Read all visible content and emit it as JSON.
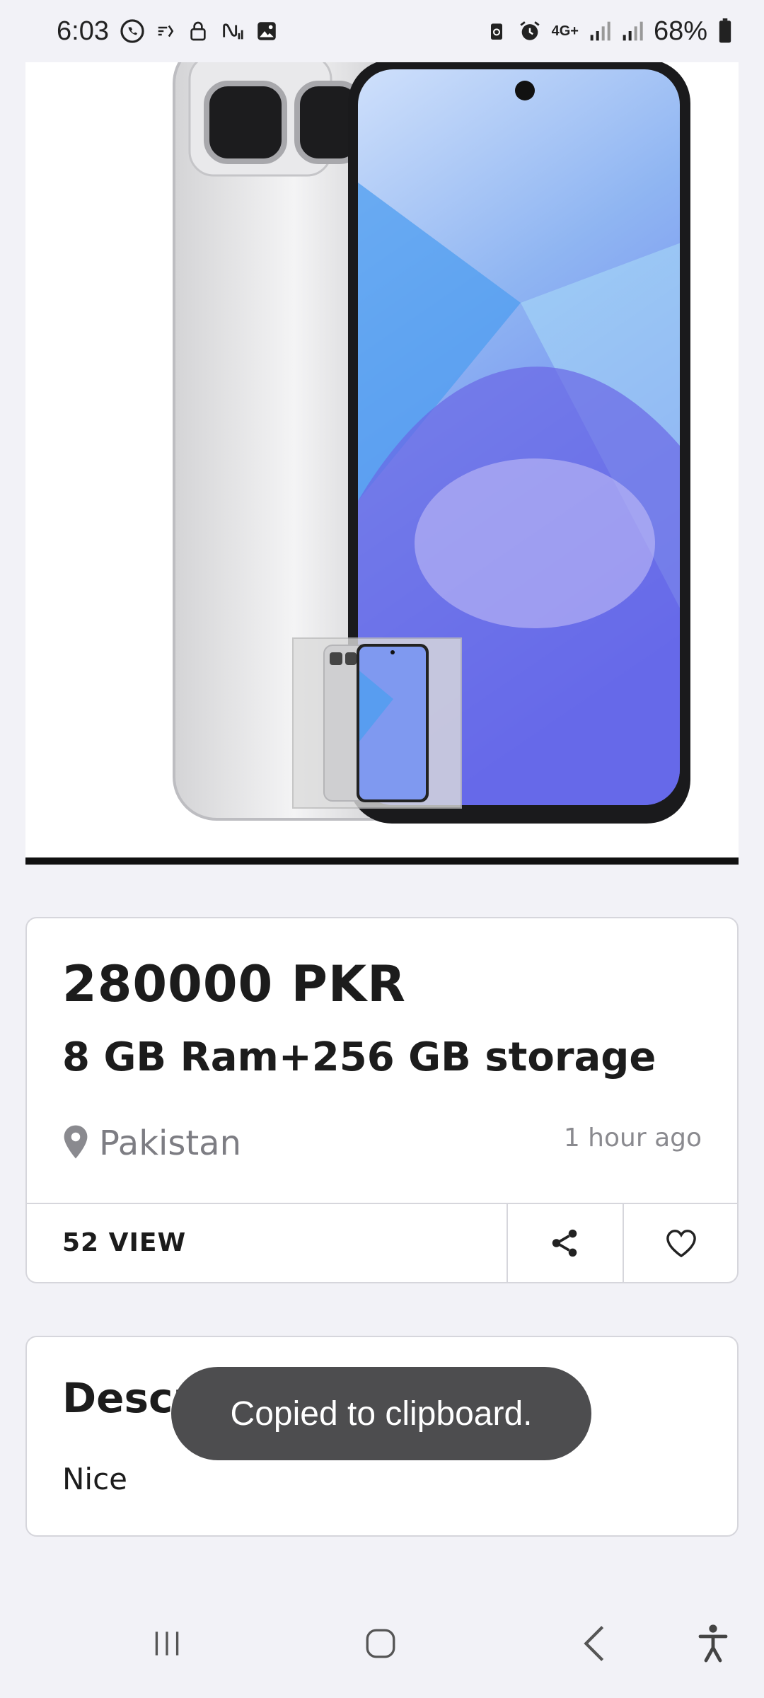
{
  "status_bar": {
    "time": "6:03",
    "network": "4G+",
    "battery": "68%"
  },
  "product": {
    "price": "280000 PKR",
    "title": "8 GB Ram+256 GB storage",
    "location": "Pakistan",
    "posted": "1 hour ago",
    "views": "52 VIEW"
  },
  "description": {
    "heading": "Description",
    "body": "Nice"
  },
  "toast": {
    "message": "Copied to clipboard."
  },
  "colors": {
    "background": "#f2f2f7",
    "toast": "#4d4d4f",
    "phone_screen": "#6a7cf0"
  },
  "icons": {
    "share": "share-icon",
    "favorite": "heart-icon",
    "location": "location-pin-icon"
  }
}
